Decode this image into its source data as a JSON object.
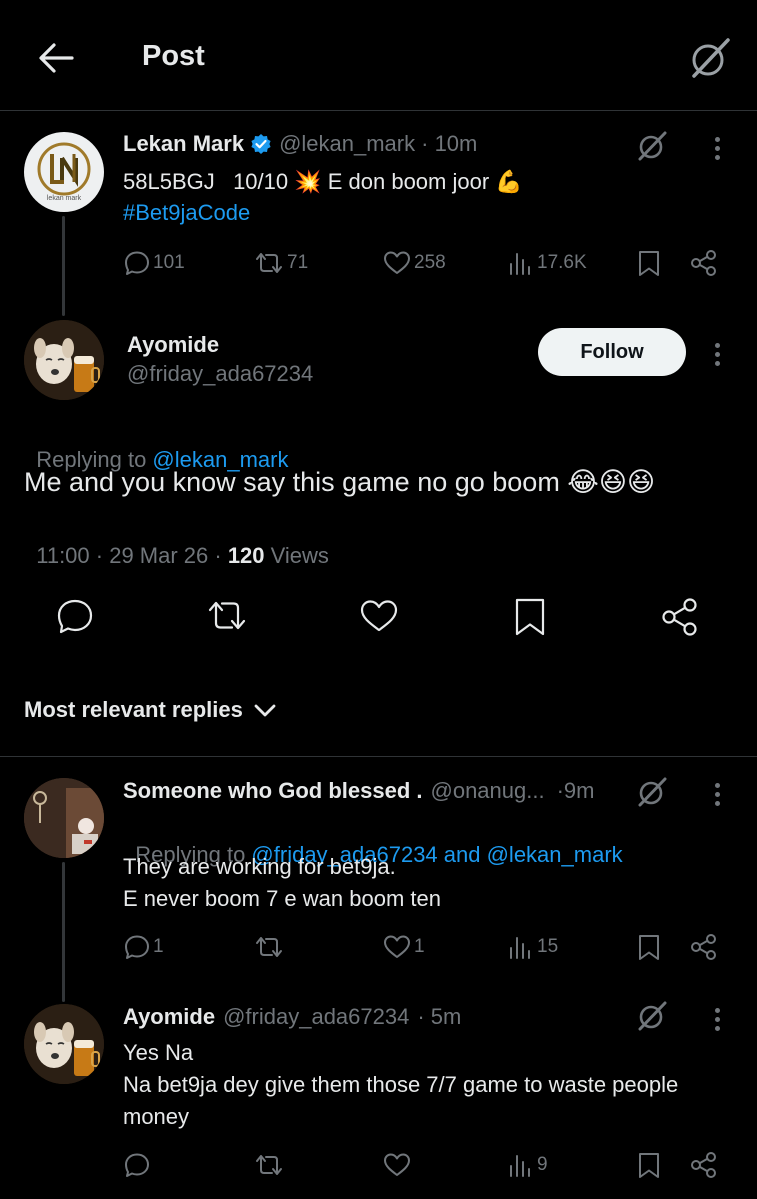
{
  "header": {
    "title": "Post"
  },
  "parent_post": {
    "display_name": "Lekan Mark",
    "handle": "@lekan_mark",
    "time": "· 10m",
    "text_line1": "58L5BGJ   10/10 💥 E don boom joor 💪",
    "hashtag": "#Bet9jaCode",
    "avatar_text": "lekan mark",
    "stats": {
      "replies": "101",
      "reposts": "71",
      "likes": "258",
      "views": "17.6K"
    }
  },
  "main_post": {
    "display_name": "Ayomide",
    "handle": "@friday_ada67234",
    "follow_label": "Follow",
    "replying_prefix": "Replying to ",
    "replying_to": "@lekan_mark",
    "text": "Me and you know say this game no go boom 😂😆😆",
    "timestamp": "11:00 · 29 Mar 26 · ",
    "views_count": "120",
    "views_label": " Views"
  },
  "sort": {
    "label": "Most relevant replies"
  },
  "replies": [
    {
      "display_name": "Someone who God blessed .",
      "handle": "@onanug...",
      "time": "·9m",
      "replying_prefix": "Replying to ",
      "replying_to": "@friday_ada67234 and @lekan_mark",
      "line1": "They are working for bet9ja.",
      "line2": "E never boom 7 e wan boom ten",
      "stats": {
        "replies": "1",
        "likes": "1",
        "views": "15"
      }
    },
    {
      "display_name": "Ayomide",
      "handle": "@friday_ada67234",
      "time": "· 5m",
      "line1": "Yes Na",
      "line2": "Na bet9ja dey give them those 7/7 game to waste people",
      "line3": "money",
      "stats": {
        "views": "9"
      }
    }
  ],
  "colors": {
    "accent": "#1d9bf0",
    "background": "#000000",
    "text": "#e7e9ea",
    "muted": "#71767b",
    "verified": "#1d9bf0"
  }
}
